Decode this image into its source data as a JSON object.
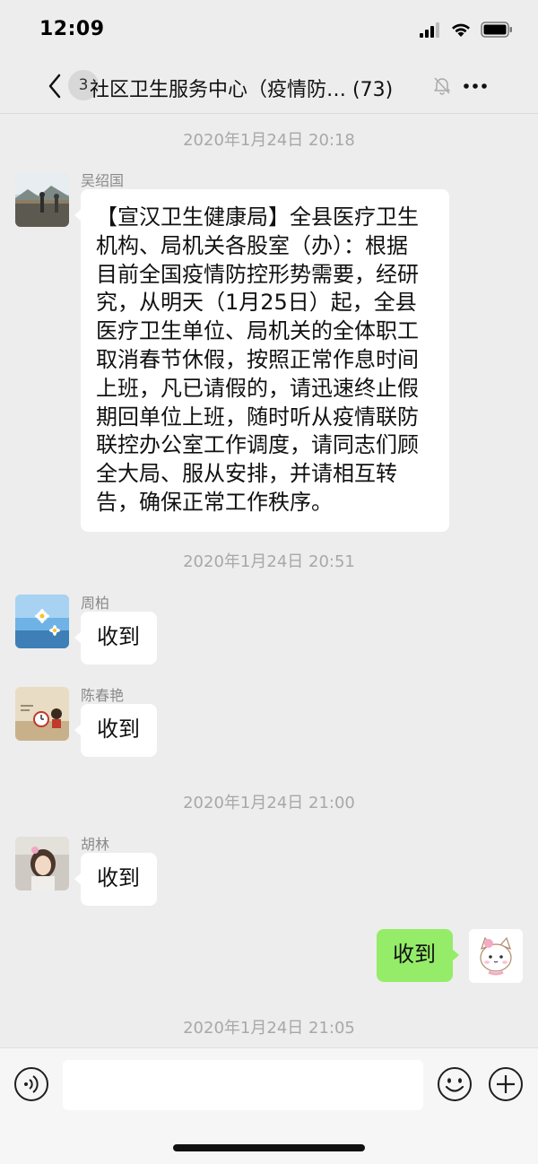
{
  "status_bar": {
    "time": "12:09"
  },
  "header": {
    "unread_count": "3",
    "title": "社区卫生服务中心（疫情防… (73)"
  },
  "messages": [
    {
      "timestamp": "2020年1月24日 20:18"
    },
    {
      "sender": "吴绍国",
      "text": "【宣汉卫生健康局】全县医疗卫生\n机构、局机关各股室（办）：根据\n目前全国疫情防控形势需要，经研\n究，从明天（1月25日）起，全县\n医疗卫生单位、局机关的全体职工\n取消春节休假，按照正常作息时间\n上班，凡已请假的，请迅速终止假\n期回单位上班，随时听从疫情联防\n联控办公室工作调度，请同志们顾\n全大局、服从安排，并请相互转\n告，确保正常工作秩序。"
    },
    {
      "timestamp": "2020年1月24日 20:51"
    },
    {
      "sender": "周柏",
      "text": "收到"
    },
    {
      "sender": "陈春艳",
      "text": "收到"
    },
    {
      "timestamp": "2020年1月24日 21:00"
    },
    {
      "sender": "胡林",
      "text": "收到"
    },
    {
      "sender": "",
      "text": "收到"
    },
    {
      "timestamp": "2020年1月24日 21:05"
    }
  ],
  "input_bar": {
    "placeholder": ""
  },
  "icons": {
    "back": "chevron-left-icon",
    "mute": "bell-slash-icon",
    "more": "more-dots-icon",
    "voice": "voice-icon",
    "emoji": "emoji-icon",
    "plus": "plus-icon"
  },
  "colors": {
    "background": "#ededed",
    "bubble_other": "#ffffff",
    "bubble_self": "#95ec69",
    "timestamp": "#a8a8a8"
  }
}
